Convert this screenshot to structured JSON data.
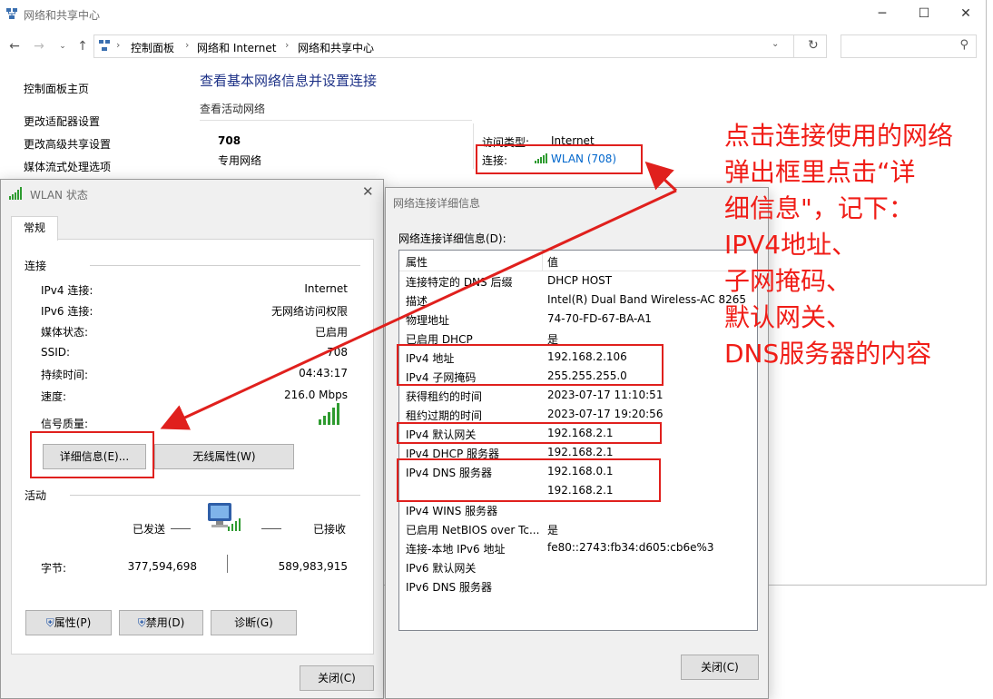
{
  "explorer": {
    "title": "网络和共享中心",
    "breadcrumb": [
      "控制面板",
      "网络和 Internet",
      "网络和共享中心"
    ],
    "sidebar": [
      "控制面板主页",
      "更改适配器设置",
      "更改高级共享设置",
      "媒体流式处理选项"
    ],
    "heading": "查看基本网络信息并设置连接",
    "active_networks_label": "查看活动网络",
    "network_name": "708",
    "network_type": "专用网络",
    "access_type_label": "访问类型:",
    "access_type_value": "Internet",
    "connection_label": "连接:",
    "connection_link": "WLAN (708)"
  },
  "wlan": {
    "title": "WLAN 状态",
    "tab": "常规",
    "connection_group": "连接",
    "rows": [
      {
        "label": "IPv4 连接:",
        "value": "Internet"
      },
      {
        "label": "IPv6 连接:",
        "value": "无网络访问权限"
      },
      {
        "label": "媒体状态:",
        "value": "已启用"
      },
      {
        "label": "SSID:",
        "value": "708"
      },
      {
        "label": "持续时间:",
        "value": "04:43:17"
      },
      {
        "label": "速度:",
        "value": "216.0 Mbps"
      }
    ],
    "signal_label": "信号质量:",
    "details_button": "详细信息(E)...",
    "wireless_button": "无线属性(W)",
    "activity_group": "活动",
    "sent_label": "已发送",
    "received_label": "已接收",
    "bytes_label": "字节:",
    "bytes_sent": "377,594,698",
    "bytes_received": "589,983,915",
    "properties_button": "属性(P)",
    "disable_button": "禁用(D)",
    "diagnose_button": "诊断(G)",
    "close_button": "关闭(C)"
  },
  "details": {
    "title": "网络连接详细信息",
    "list_label": "网络连接详细信息(D):",
    "col_property": "属性",
    "col_value": "值",
    "rows": [
      {
        "p": "连接特定的 DNS 后缀",
        "v": "DHCP HOST"
      },
      {
        "p": "描述",
        "v": "Intel(R) Dual Band Wireless-AC 8265"
      },
      {
        "p": "物理地址",
        "v": "74-70-FD-67-BA-A1"
      },
      {
        "p": "已启用 DHCP",
        "v": "是"
      },
      {
        "p": "IPv4 地址",
        "v": "192.168.2.106"
      },
      {
        "p": "IPv4 子网掩码",
        "v": "255.255.255.0"
      },
      {
        "p": "获得租约的时间",
        "v": "2023-07-17 11:10:51"
      },
      {
        "p": "租约过期的时间",
        "v": "2023-07-17 19:20:56"
      },
      {
        "p": "IPv4 默认网关",
        "v": "192.168.2.1"
      },
      {
        "p": "IPv4 DHCP 服务器",
        "v": "192.168.2.1"
      },
      {
        "p": "IPv4 DNS 服务器",
        "v": "192.168.0.1"
      },
      {
        "p": "",
        "v": "192.168.2.1"
      },
      {
        "p": "IPv4 WINS 服务器",
        "v": ""
      },
      {
        "p": "已启用 NetBIOS over Tc...",
        "v": "是"
      },
      {
        "p": "连接-本地 IPv6 地址",
        "v": "fe80::2743:fb34:d605:cb6e%3"
      },
      {
        "p": "IPv6 默认网关",
        "v": ""
      },
      {
        "p": "IPv6 DNS 服务器",
        "v": ""
      }
    ],
    "close_button": "关闭(C)"
  },
  "annotation": {
    "text": "点击连接使用的网络\n弹出框里点击“详\n细信息\"，记下：\nIPV4地址、\n子网掩码、\n默认网关、\nDNS服务器的内容"
  }
}
